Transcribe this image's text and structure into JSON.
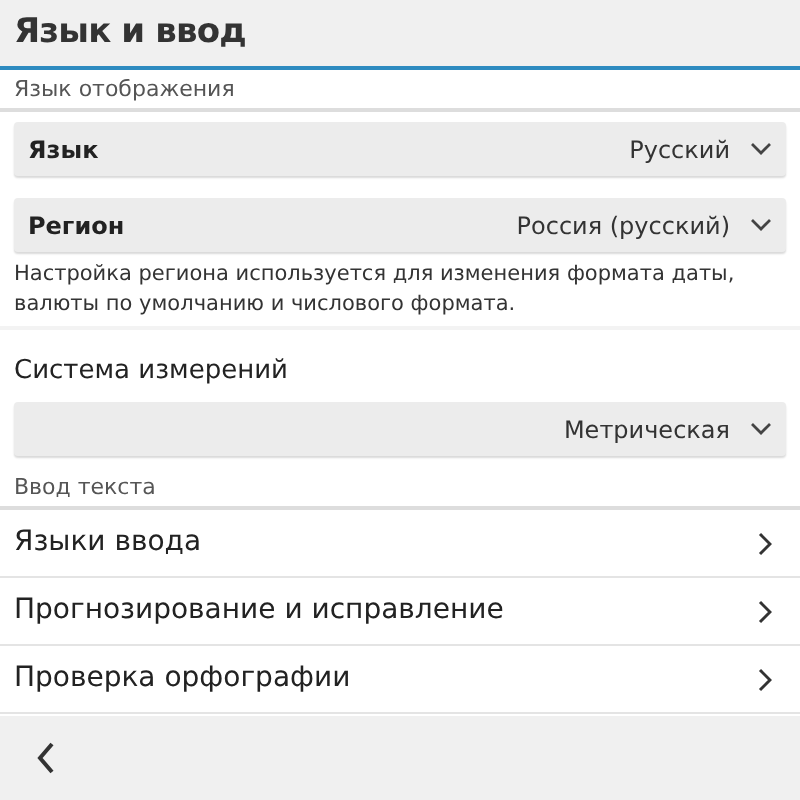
{
  "title": "Язык и ввод",
  "items": [
    {
      "kind": "header",
      "text": "Язык отображения"
    },
    {
      "kind": "dropdown",
      "label": "Язык",
      "value": "Русский"
    },
    {
      "kind": "dropdown",
      "label": "Регион",
      "value": "Россия (русский)"
    },
    {
      "kind": "note",
      "text": "Настройка региона используется для изменения формата даты, валюты по умолчанию и числового формата."
    },
    {
      "kind": "label",
      "text": "Система измерений"
    },
    {
      "kind": "dropdown",
      "value": "Метрическая"
    },
    {
      "kind": "header",
      "text": "Ввод текста"
    },
    {
      "kind": "link",
      "label": "Языки ввода"
    },
    {
      "kind": "link",
      "label": "Прогнозирование и исправление"
    },
    {
      "kind": "link",
      "label": "Проверка орфографии"
    }
  ]
}
